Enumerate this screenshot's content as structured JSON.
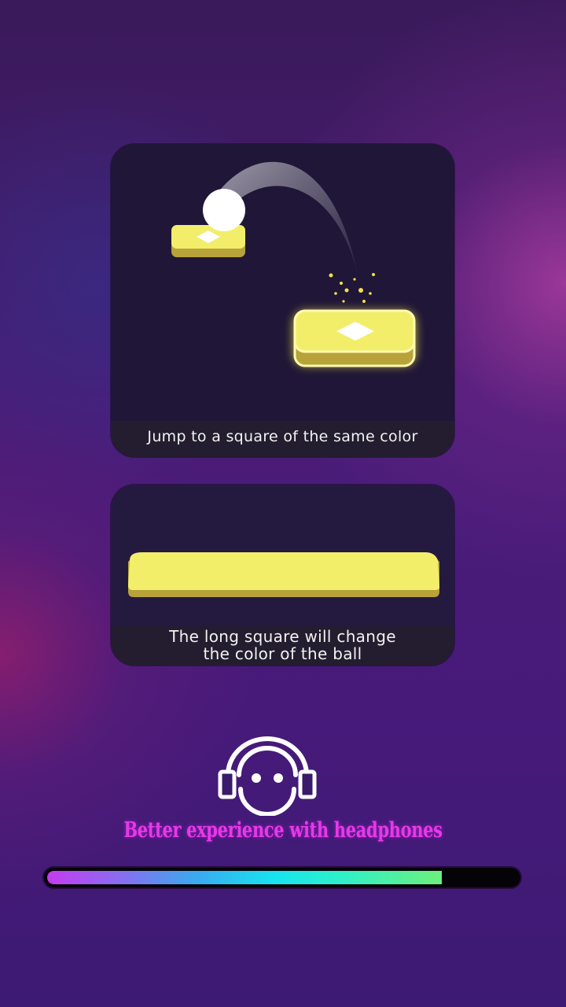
{
  "tutorial": {
    "card1_caption": "Jump to a square of the same color",
    "card2_caption_line1": "The long square will change",
    "card2_caption_line2": "the color of the ball"
  },
  "hint": {
    "text": "Better experience with headphones"
  },
  "loading": {
    "progress_percent": 84
  },
  "colors": {
    "tile_yellow": "#f2ee6a",
    "tile_side": "#b8a23a",
    "hint_magenta": "#e838e8",
    "card_bg": "#1f1638"
  },
  "icons": [
    "headphones-icon",
    "diamond-icon",
    "ball-icon"
  ]
}
